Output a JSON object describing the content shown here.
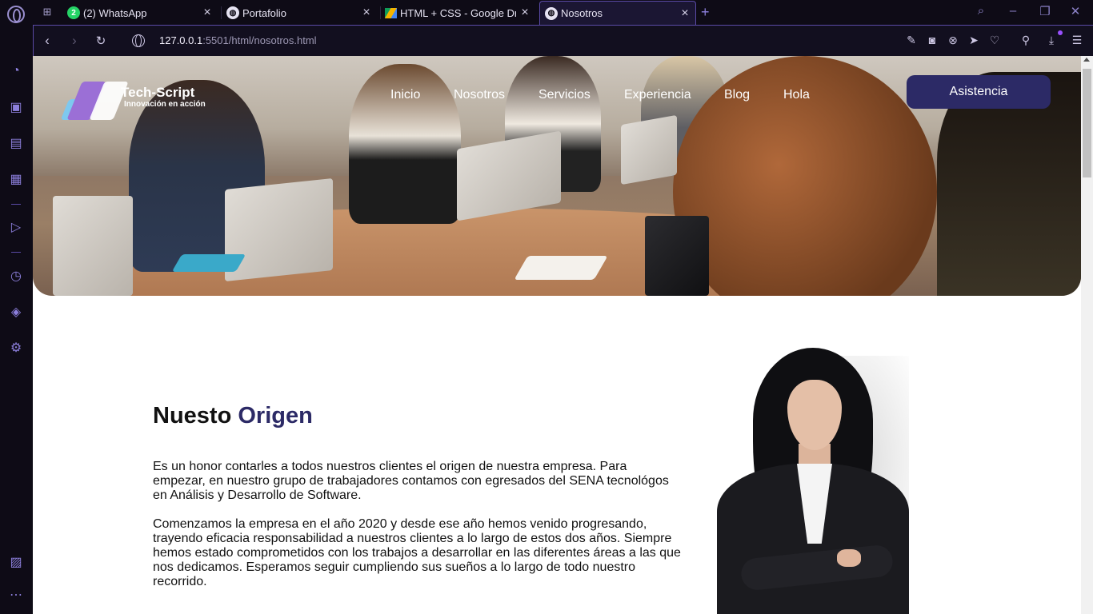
{
  "browser": {
    "tabs": [
      {
        "title": "(2) WhatsApp",
        "badge": "2",
        "active": false
      },
      {
        "title": "Portafolio",
        "active": false
      },
      {
        "title": "HTML + CSS - Google Drive",
        "active": false
      },
      {
        "title": "Nosotros",
        "active": true
      }
    ],
    "url_host": "127.0.0.1",
    "url_rest": ":5501/html/nosotros.html",
    "accent_color": "#5a4aa6"
  },
  "sidebar": {
    "icons": [
      "speed-dial-icon",
      "shopping-icon",
      "twitch-icon",
      "extensions-icon",
      "player-icon",
      "history-icon",
      "cube-icon",
      "settings-icon",
      "gallery-icon",
      "more-icon"
    ]
  },
  "page": {
    "logo": {
      "name": "Tech-Script",
      "tagline": "Innovación en acción"
    },
    "nav": [
      "Inicio",
      "Nosotros",
      "Servicios",
      "Experiencia",
      "Blog",
      "Hola"
    ],
    "cta": "Asistencia",
    "about": {
      "title_main": "Nuesto",
      "title_accent": "Origen",
      "paragraph1": "Es un honor contarles a todos nuestros clientes el origen de nuestra empresa. Para empezar, en nuestro grupo de trabajadores contamos con egresados del SENA tecnológos en Análisis y Desarrollo de Software.",
      "paragraph2": "Comenzamos la empresa en el año 2020 y desde ese año hemos venido progresando, trayendo eficacia responsabilidad a nuestros clientes a lo largo de estos dos años. Siempre hemos estado comprometidos con los trabajos a desarrollar en las diferentes áreas a las que nos dedicamos. Esperamos seguir cumpliendo sus sueños a lo largo de todo nuestro recorrido."
    },
    "colors": {
      "brand_dark": "#2c2a66",
      "logo_purple": "#9b6fd6",
      "logo_blue": "#7ec8ef"
    }
  }
}
